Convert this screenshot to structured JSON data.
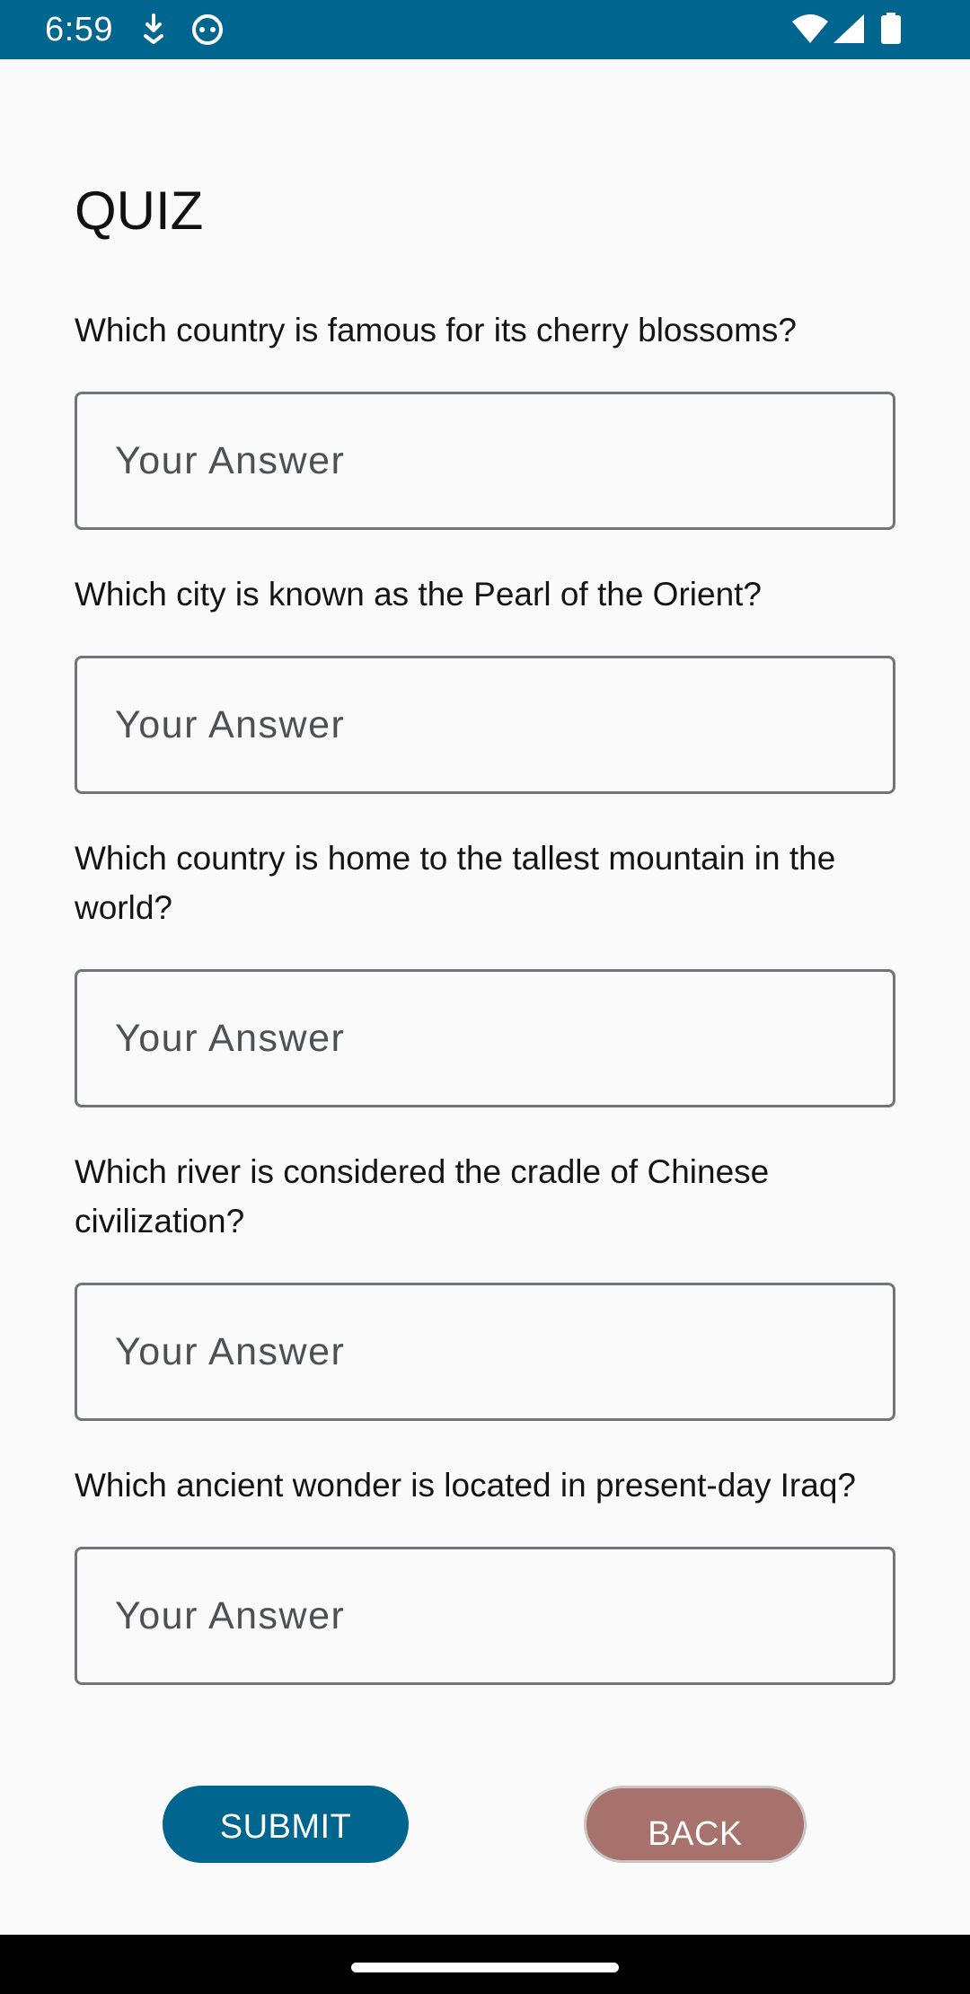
{
  "status_bar": {
    "time": "6:59",
    "icons": [
      "download-icon",
      "face-icon",
      "wifi-icon",
      "signal-icon",
      "battery-icon"
    ],
    "background": "#006690"
  },
  "title": "QUIZ",
  "questions": [
    {
      "text": "Which country is famous for its cherry blossoms?",
      "placeholder": "Your Answer",
      "value": ""
    },
    {
      "text": "Which city is known as the Pearl of the Orient?",
      "placeholder": "Your Answer",
      "value": ""
    },
    {
      "text": "Which country is home to the tallest mountain in the world?",
      "placeholder": "Your Answer",
      "value": ""
    },
    {
      "text": "Which river is considered the cradle of Chinese civilization?",
      "placeholder": "Your Answer",
      "value": ""
    },
    {
      "text": "Which ancient wonder is located in present-day Iraq?",
      "placeholder": "Your Answer",
      "value": ""
    }
  ],
  "buttons": {
    "submit_label": "SUBMIT",
    "back_label": "BACK",
    "submit_color": "#006690",
    "back_color": "#a6726b"
  }
}
